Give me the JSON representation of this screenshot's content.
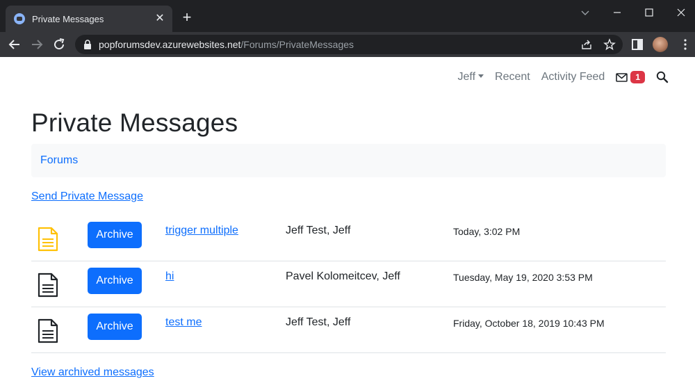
{
  "browser": {
    "tab_title": "Private Messages",
    "url_host": "popforumsdev.azurewebsites.net",
    "url_path": "/Forums/PrivateMessages"
  },
  "nav": {
    "user": "Jeff",
    "recent": "Recent",
    "activity_feed": "Activity Feed",
    "unread_count": "1"
  },
  "page": {
    "title": "Private Messages",
    "breadcrumb": "Forums",
    "send_link": "Send Private Message",
    "archived_link": "View archived messages"
  },
  "messages": [
    {
      "unread": true,
      "archive_label": "Archive",
      "subject": "trigger multiple",
      "participants": "Jeff Test, Jeff",
      "date": "Today, 3:02 PM"
    },
    {
      "unread": false,
      "archive_label": "Archive",
      "subject": "hi",
      "participants": "Pavel Kolomeitcev, Jeff",
      "date": "Tuesday, May 19, 2020 3:53 PM"
    },
    {
      "unread": false,
      "archive_label": "Archive",
      "subject": "test me",
      "participants": "Jeff Test, Jeff",
      "date": "Friday, October 18, 2019 10:43 PM"
    }
  ],
  "colors": {
    "primary": "#0d6efd",
    "badge": "#dc3545",
    "unread_icon": "#ffc107",
    "read_icon": "#212529"
  }
}
